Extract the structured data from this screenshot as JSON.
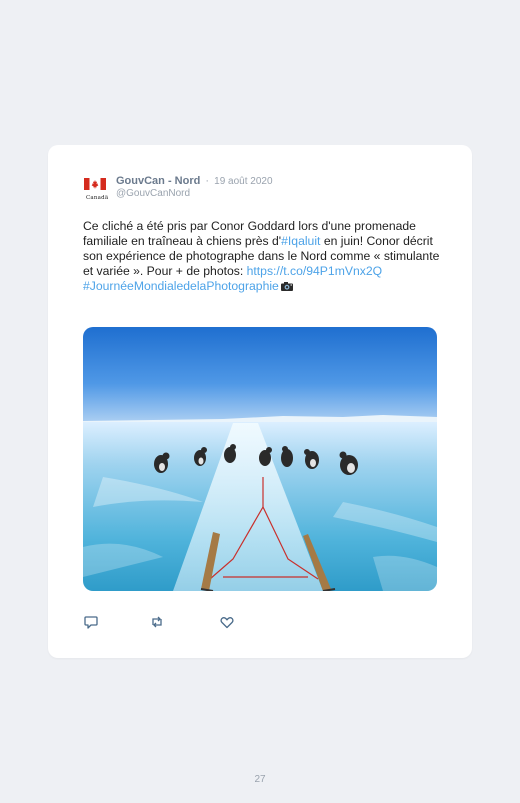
{
  "tweet": {
    "logo_name": "canada-flag-logo",
    "logo_wordmark": "Canadä",
    "author": "GouvCan - Nord",
    "separator": "·",
    "date": "19 août 2020",
    "handle": "@GouvCanNord",
    "text_part1": "Ce cliché a été pris par Conor Goddard lors d'une promenade familiale en traîneau à chiens près d'",
    "hashtag_iqaluit": "#Iqaluit",
    "text_part2": " en juin! Conor décrit son expérience de photographe dans le Nord comme « stimulante et variée ». Pour + de photos: ",
    "link": "https://t.co/94P1mVnx2Q",
    "hashtag_photo_day": "#JournéeMondialedelaPhotographie",
    "emoji_name": "camera-icon",
    "image_name": "dog-sled-on-ice-photo",
    "actions": [
      "reply-icon",
      "retweet-icon",
      "like-icon"
    ]
  },
  "page": {
    "number": "27"
  },
  "colors": {
    "background": "#eef0f4",
    "card": "#ffffff",
    "link": "#4da3e8",
    "author": "#6b7a8d",
    "muted": "#9aa3ae",
    "flag_red": "#d52b1e"
  }
}
